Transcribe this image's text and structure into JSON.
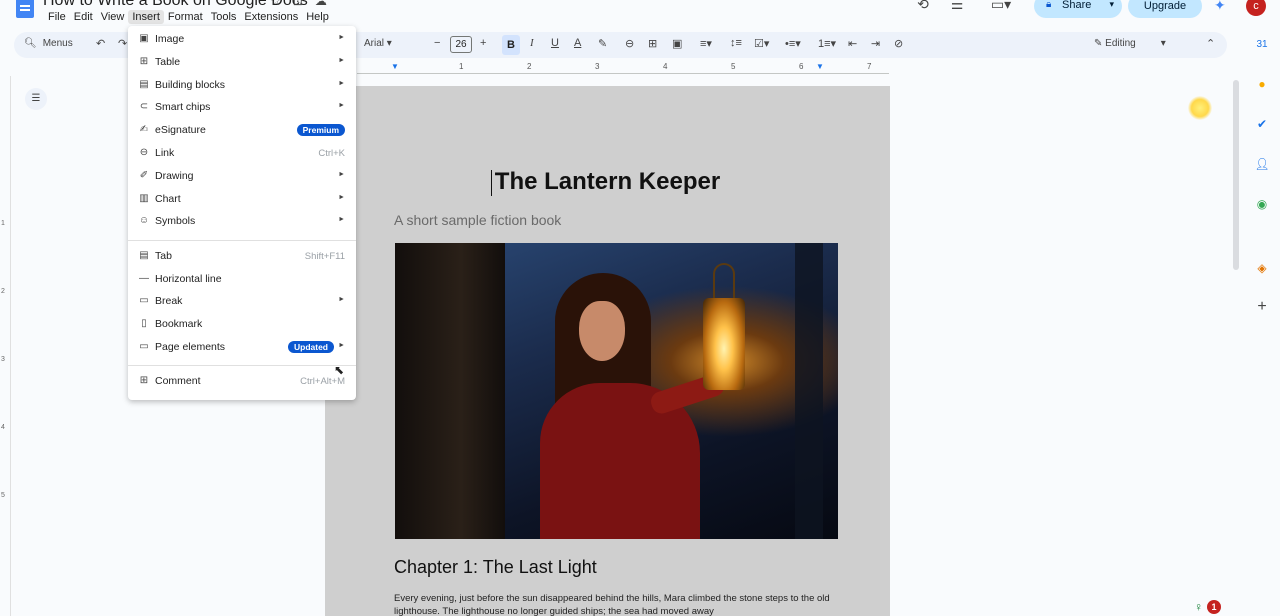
{
  "app": {
    "doc_title": "How to Write a Book on Google Docs",
    "menubar": [
      "File",
      "Edit",
      "View",
      "Insert",
      "Format",
      "Tools",
      "Extensions",
      "Help"
    ],
    "active_menu": "Insert",
    "share_label": "Share",
    "upgrade_label": "Upgrade",
    "avatar_letter": "c"
  },
  "toolbar": {
    "menus_label": "Menus",
    "font": "Arial",
    "font_size": "26",
    "mode": "Editing"
  },
  "ruler": [
    "1",
    "2",
    "3",
    "4",
    "5",
    "6",
    "7"
  ],
  "vruler": [
    "1",
    "2",
    "3",
    "4",
    "5"
  ],
  "insert_menu": {
    "items": [
      {
        "label": "Image",
        "icon": "image-icon",
        "submenu": true
      },
      {
        "label": "Table",
        "icon": "table-icon",
        "submenu": true
      },
      {
        "label": "Building blocks",
        "icon": "building-blocks-icon",
        "submenu": true
      },
      {
        "label": "Smart chips",
        "icon": "smart-chips-icon",
        "submenu": true
      },
      {
        "label": "eSignature",
        "icon": "esignature-icon",
        "badge": "Premium"
      },
      {
        "label": "Link",
        "icon": "link-icon",
        "shortcut": "Ctrl+K"
      },
      {
        "label": "Drawing",
        "icon": "drawing-icon",
        "submenu": true
      },
      {
        "label": "Chart",
        "icon": "chart-icon",
        "submenu": true
      },
      {
        "label": "Symbols",
        "icon": "symbols-icon",
        "submenu": true
      },
      {
        "label": "Tab",
        "icon": "tab-icon",
        "shortcut": "Shift+F11"
      },
      {
        "label": "Horizontal line",
        "icon": "horizontal-line-icon"
      },
      {
        "label": "Break",
        "icon": "break-icon",
        "submenu": true
      },
      {
        "label": "Bookmark",
        "icon": "bookmark-icon"
      },
      {
        "label": "Page elements",
        "icon": "page-elements-icon",
        "badge": "Updated",
        "submenu": true
      },
      {
        "label": "Comment",
        "icon": "comment-icon",
        "shortcut": "Ctrl+Alt+M"
      }
    ]
  },
  "document": {
    "title": "The Lantern Keeper",
    "subtitle": "A short sample fiction book",
    "chapter": "Chapter 1: The Last Light",
    "body": "Every evening, just before the sun disappeared behind the hills, Mara climbed the stone steps to the old lighthouse. The lighthouse no longer guided ships; the sea had moved away"
  },
  "status": {
    "notification_count": "1"
  },
  "colors": {
    "accent": "#0b57d0",
    "share_bg": "#c2e7ff",
    "toolbar_bg": "#edf2fa"
  }
}
